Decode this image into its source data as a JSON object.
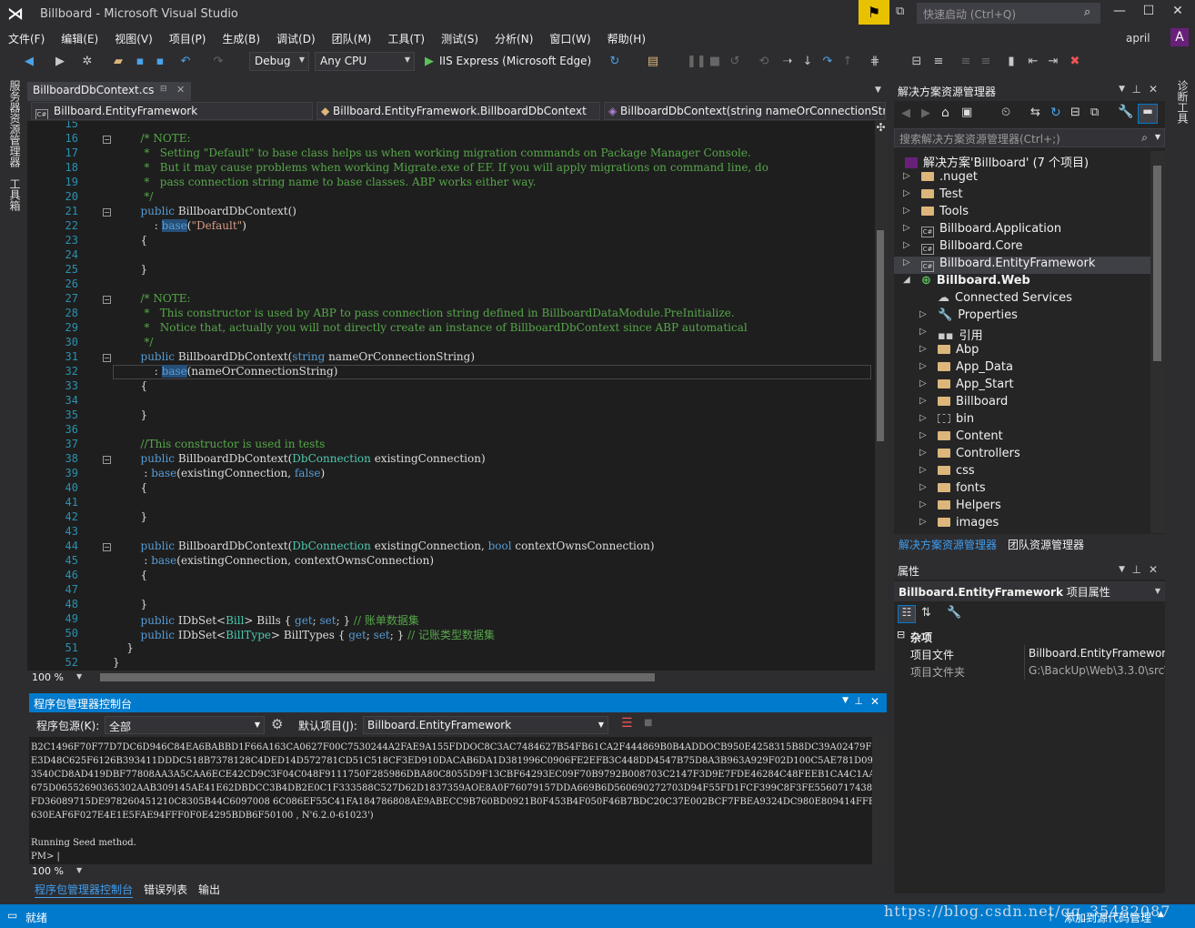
{
  "window": {
    "title": "Billboard - Microsoft Visual Studio",
    "quick_launch": "快速启动 (Ctrl+Q)",
    "user": "april",
    "avatar": "A"
  },
  "menu": [
    "文件(F)",
    "编辑(E)",
    "视图(V)",
    "项目(P)",
    "生成(B)",
    "调试(D)",
    "团队(M)",
    "工具(T)",
    "测试(S)",
    "分析(N)",
    "窗口(W)",
    "帮助(H)"
  ],
  "toolbar": {
    "config": "Debug",
    "platform": "Any CPU",
    "run": "IIS Express (Microsoft Edge)"
  },
  "left_tabs": [
    "服务器资源管理器",
    "工具箱"
  ],
  "right_tabs": [
    "诊断工具"
  ],
  "editor": {
    "tab": "BillboardDbContext.cs",
    "nav_project": "Billboard.EntityFramework",
    "nav_class": "Billboard.EntityFramework.BillboardDbContext",
    "nav_member": "BillboardDbContext(string nameOrConnectionString)",
    "zoom": "100 %",
    "line_numbers": [
      "15",
      "16",
      "17",
      "18",
      "19",
      "20",
      "21",
      "22",
      "23",
      "24",
      "25",
      "26",
      "27",
      "28",
      "29",
      "30",
      "31",
      "32",
      "33",
      "34",
      "35",
      "36",
      "37",
      "38",
      "39",
      "40",
      "41",
      "42",
      "43",
      "44",
      "45",
      "46",
      "47",
      "48",
      "49",
      "50",
      "51",
      "52"
    ]
  },
  "pm": {
    "title": "程序包管理器控制台",
    "source_label": "程序包源(K):",
    "source_value": "全部",
    "project_label": "默认项目(J):",
    "project_value": "Billboard.EntityFramework",
    "output": [
      "B2C1496F70F77D7DC6D946C84EA6BABBD1F66A163CA0627F00C7530244A2FAE9A155FDDOC8C3AC7484627B54FB61CA2F444869B0B4ADDOCB950E4258315B8DC39A02479F0A85AE51FDDOCAA3",
      "E3D48C625F6126B393411DDDC518B7378128C4DED14D572781CD51C518CF3ED910DACAB6DA1D381996C0906FE2EFB3C448DD4547B75D8A3B963A929F02D100C5AE781D0929EF44D036E537E72",
      "3540CD8AD419DBF77808AA3A5CAA6ECE42CD9C3F04C048F9111750F285986DBA80C8055D9F13CBF64293EC09F70B9792B008703C2147F3D9E7FDE46284C48FEEB1CA4C1AA06715C876AAE819",
      "675D06552690365302AAB309145AE41E62DBDCC3B4DB2E0C1F333588C527D62D1837359AOE8A0F76079157DDA669B6D560690272703D94F55FD1FCF399C8F3FE556071743806806 28B2CAA7E8",
      "FD36089715DE978260451210C8305B44C6097008 6C086EF55C41FA184786808AE9ABECC9B760BD0921B0F453B4F050F46B7BDC20C37E002BCF7FBEA9324DC980E809414FFBF179E0AD126F9D1",
      "630EAF6F027E4E1E5FAE94FFF0F0E4295BDB6F50100 , N'6.2.0-61023')",
      "",
      "Running Seed method.",
      "PM> |"
    ],
    "zoom": "100 %"
  },
  "bottom_tabs": [
    "程序包管理器控制台",
    "错误列表",
    "输出"
  ],
  "solution": {
    "title": "解决方案资源管理器",
    "search": "搜索解决方案资源管理器(Ctrl+;)",
    "root": "解决方案'Billboard' (7 个项目)",
    "items": [
      ".nuget",
      "Test",
      "Tools",
      "Billboard.Application",
      "Billboard.Core",
      "Billboard.EntityFramework",
      "Billboard.Web",
      "Connected Services",
      "Properties",
      "引用",
      "Abp",
      "App_Data",
      "App_Start",
      "Billboard",
      "bin",
      "Content",
      "Controllers",
      "css",
      "fonts",
      "Helpers",
      "images"
    ],
    "tabs": [
      "解决方案资源管理器",
      "团队资源管理器"
    ]
  },
  "properties": {
    "title": "属性",
    "object": "Billboard.EntityFramework",
    "object_suffix": "项目属性",
    "category": "杂项",
    "rows": [
      {
        "name": "项目文件",
        "value": "Billboard.EntityFramework"
      },
      {
        "name": "项目文件夹",
        "value": "G:\\BackUp\\Web\\3.3.0\\src\\"
      }
    ]
  },
  "status": {
    "ready": "就绪",
    "source_control": "添加到源代码管理",
    "watermark": "https://blog.csdn.net/qq_35482087"
  },
  "colors": {
    "accent": "#007acc",
    "editor_bg": "#1e1e1e",
    "keyword": "#569cd6",
    "comment": "#57a64a",
    "string": "#d69d85",
    "type": "#4ec9b0"
  }
}
